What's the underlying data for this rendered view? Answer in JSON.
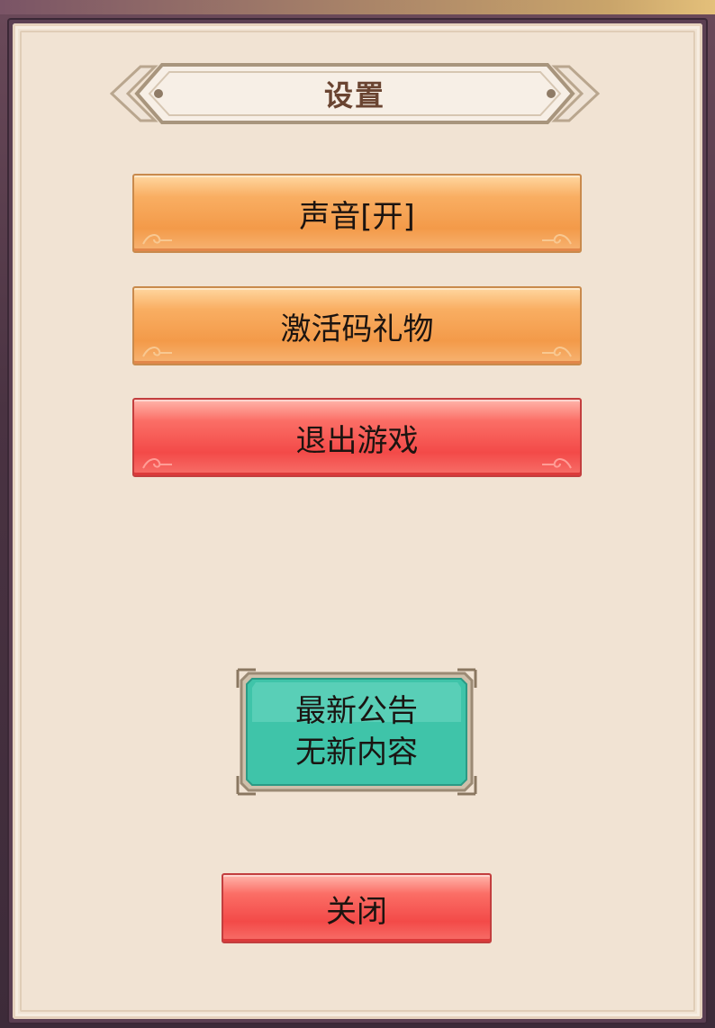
{
  "dialog": {
    "title": "设置"
  },
  "menu": {
    "sound_label": "声音[开]",
    "gift_code_label": "激活码礼物",
    "exit_label": "退出游戏"
  },
  "notice": {
    "line1": "最新公告",
    "line2": "无新内容"
  },
  "footer": {
    "close_label": "关闭"
  },
  "colors": {
    "orange_button": "#f39a49",
    "red_button": "#f34a48",
    "teal_button": "#3fc4a9",
    "panel_bg": "#f1e3d3",
    "frame": "#5b3f52",
    "title_text": "#6a4431"
  }
}
